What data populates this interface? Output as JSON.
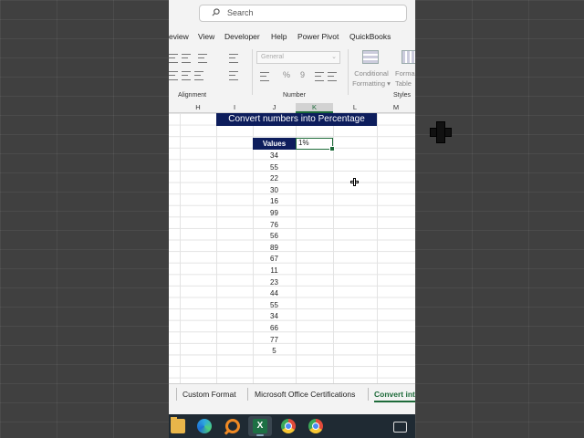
{
  "search": {
    "placeholder": "Search"
  },
  "menu": [
    "eview",
    "View",
    "Developer",
    "Help",
    "Power Pivot",
    "QuickBooks"
  ],
  "ribbon": {
    "groups": {
      "alignment": "Alignment",
      "number": "Number",
      "styles": "Styles"
    },
    "number_format": "General",
    "number_symbols": [
      "%",
      "9"
    ],
    "conditional_formatting": [
      "Conditional",
      "Formatting ▾"
    ],
    "format_table": [
      "Forma",
      "Table"
    ]
  },
  "columns": [
    "H",
    "I",
    "J",
    "K",
    "L",
    "M"
  ],
  "selected_column": "K",
  "sheet": {
    "title": "Convert numbers into Percentage",
    "values_header": "Values",
    "active_cell_value": "1%",
    "values": [
      "34",
      "55",
      "22",
      "30",
      "16",
      "99",
      "76",
      "56",
      "89",
      "67",
      "11",
      "23",
      "44",
      "55",
      "34",
      "66",
      "77",
      "5"
    ]
  },
  "sheet_tabs": [
    "Custom Format",
    "Microsoft Office Certifications",
    "Convert int"
  ],
  "active_tab_index": 2,
  "taskbar": [
    "file-explorer-icon",
    "edge-icon",
    "search-app-icon",
    "excel-icon",
    "chrome-icon",
    "chrome-profile-icon",
    "news-widget-icon"
  ],
  "colors": {
    "header_navy": "#0d1d5c",
    "excel_green": "#1e6b3a",
    "taskbar": "#1f2a33"
  }
}
